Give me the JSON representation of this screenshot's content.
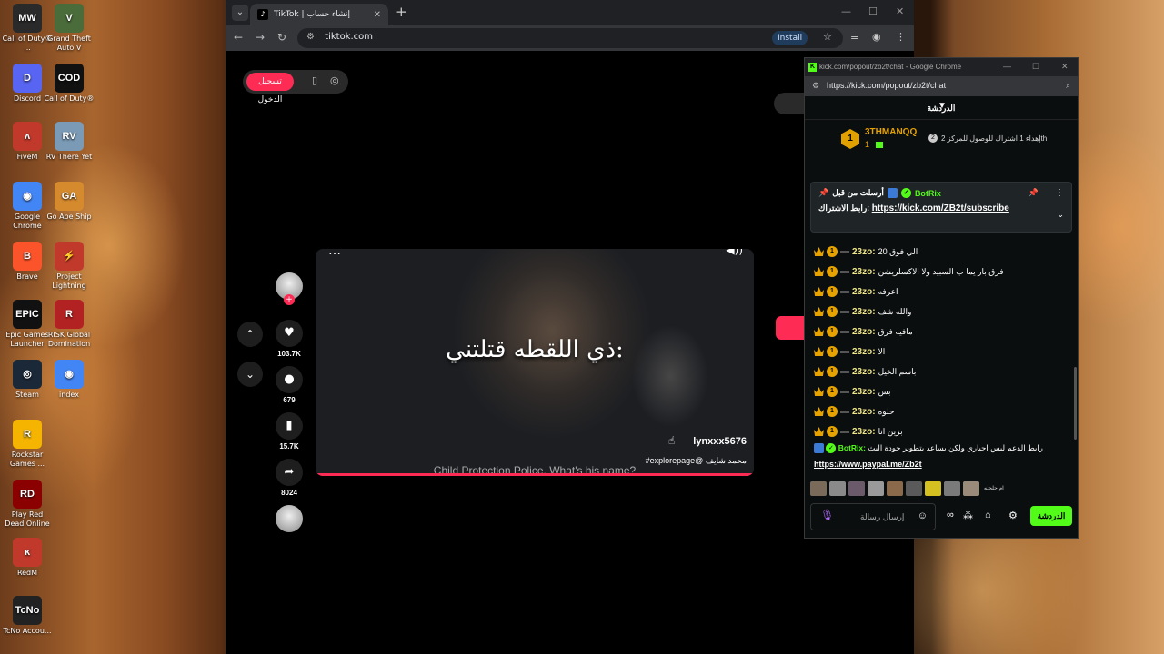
{
  "desktop": {
    "icons": [
      {
        "label": "Call of Duty® ...",
        "glyph": "MW",
        "color": "#2a2a2a"
      },
      {
        "label": "Discord",
        "glyph": "D",
        "color": "#5865f2"
      },
      {
        "label": "FiveM",
        "glyph": "ʌ",
        "color": "#c0392b"
      },
      {
        "label": "Google Chrome",
        "glyph": "◉",
        "color": "#4285f4"
      },
      {
        "label": "Brave",
        "glyph": "B",
        "color": "#fb542b"
      },
      {
        "label": "Epic Games Launcher",
        "glyph": "EPIC",
        "color": "#111111"
      },
      {
        "label": "Steam",
        "glyph": "◎",
        "color": "#1b2838"
      },
      {
        "label": "Rockstar Games ...",
        "glyph": "R",
        "color": "#f4b400"
      },
      {
        "label": "Play Red Dead Online",
        "glyph": "RD",
        "color": "#8b0000"
      },
      {
        "label": "RedM",
        "glyph": "ĸ",
        "color": "#c0392b"
      },
      {
        "label": "TcNo Accou...",
        "glyph": "TcNo",
        "color": "#222222"
      },
      {
        "label": "Grand Theft Auto V",
        "glyph": "V",
        "color": "#4a6b3a"
      },
      {
        "label": "Call of Duty®",
        "glyph": "COD",
        "color": "#111111"
      },
      {
        "label": "RV There Yet",
        "glyph": "RV",
        "color": "#7a9ab5"
      },
      {
        "label": "Go Ape Ship",
        "glyph": "GA",
        "color": "#d68a2e"
      },
      {
        "label": "Project Lightning",
        "glyph": "⚡",
        "color": "#c0392b"
      },
      {
        "label": "RISK Global Domination",
        "glyph": "R",
        "color": "#b22222"
      },
      {
        "label": "index",
        "glyph": "◉",
        "color": "#4285f4"
      }
    ]
  },
  "browser": {
    "tab_title": "TikTok | إنشاء حساب",
    "url": "tiktok.com",
    "install_label": "Install"
  },
  "tiktok": {
    "login_label": "تسجيل الدخول",
    "caption": "ذي اللقطه قتلتني:",
    "subtitle": "Child Protection Police. What's his name?",
    "username": "lynxxx5676",
    "description": "#explorepage@ محمد شايف",
    "likes": "103.7K",
    "comments": "679",
    "bookmarks": "15.7K",
    "shares": "8024",
    "progress_percent": 100
  },
  "kick": {
    "window_title": "kick.com/popout/zb2t/chat - Google Chrome",
    "url": "https://kick.com/popout/zb2t/chat",
    "header": "الدردشة",
    "goal": {
      "name": "3THMANQQ",
      "count": "1",
      "text": "إهداء 1 اشتراك للوصول للمركز 2th"
    },
    "pinned": {
      "by_label": "أرسلت من قبل",
      "bot_name": "BotRix",
      "link_label": "رابط الاشتراك:",
      "link": "https://kick.com/ZB2t/subscribe"
    },
    "messages": [
      {
        "user": "23zo:",
        "text": "الي فوق 20"
      },
      {
        "user": "23zo:",
        "text": "فرق بار يما ب السبيد ولا الاكسلريشن"
      },
      {
        "user": "23zo:",
        "text": "اعرفه"
      },
      {
        "user": "23zo:",
        "text": "والله شف"
      },
      {
        "user": "23zo:",
        "text": "مافيه فرق"
      },
      {
        "user": "23zo:",
        "text": "الا"
      },
      {
        "user": "23zo:",
        "text": "باسم الخيل"
      },
      {
        "user": "23zo:",
        "text": "بس"
      },
      {
        "user": "23zo:",
        "text": "حلوه"
      },
      {
        "user": "23zo:",
        "text": "بزين انا"
      }
    ],
    "bot_message": {
      "name": "BotRix:",
      "text": "رابط الدعم ليس اجباري ولكن يساعد بتطوير جودة البث",
      "link": "https://www.paypal.me/Zb2t"
    },
    "emote_more": "ام حلحله",
    "input_placeholder": "إرسال رسالة",
    "send_label": "الدردشة"
  }
}
